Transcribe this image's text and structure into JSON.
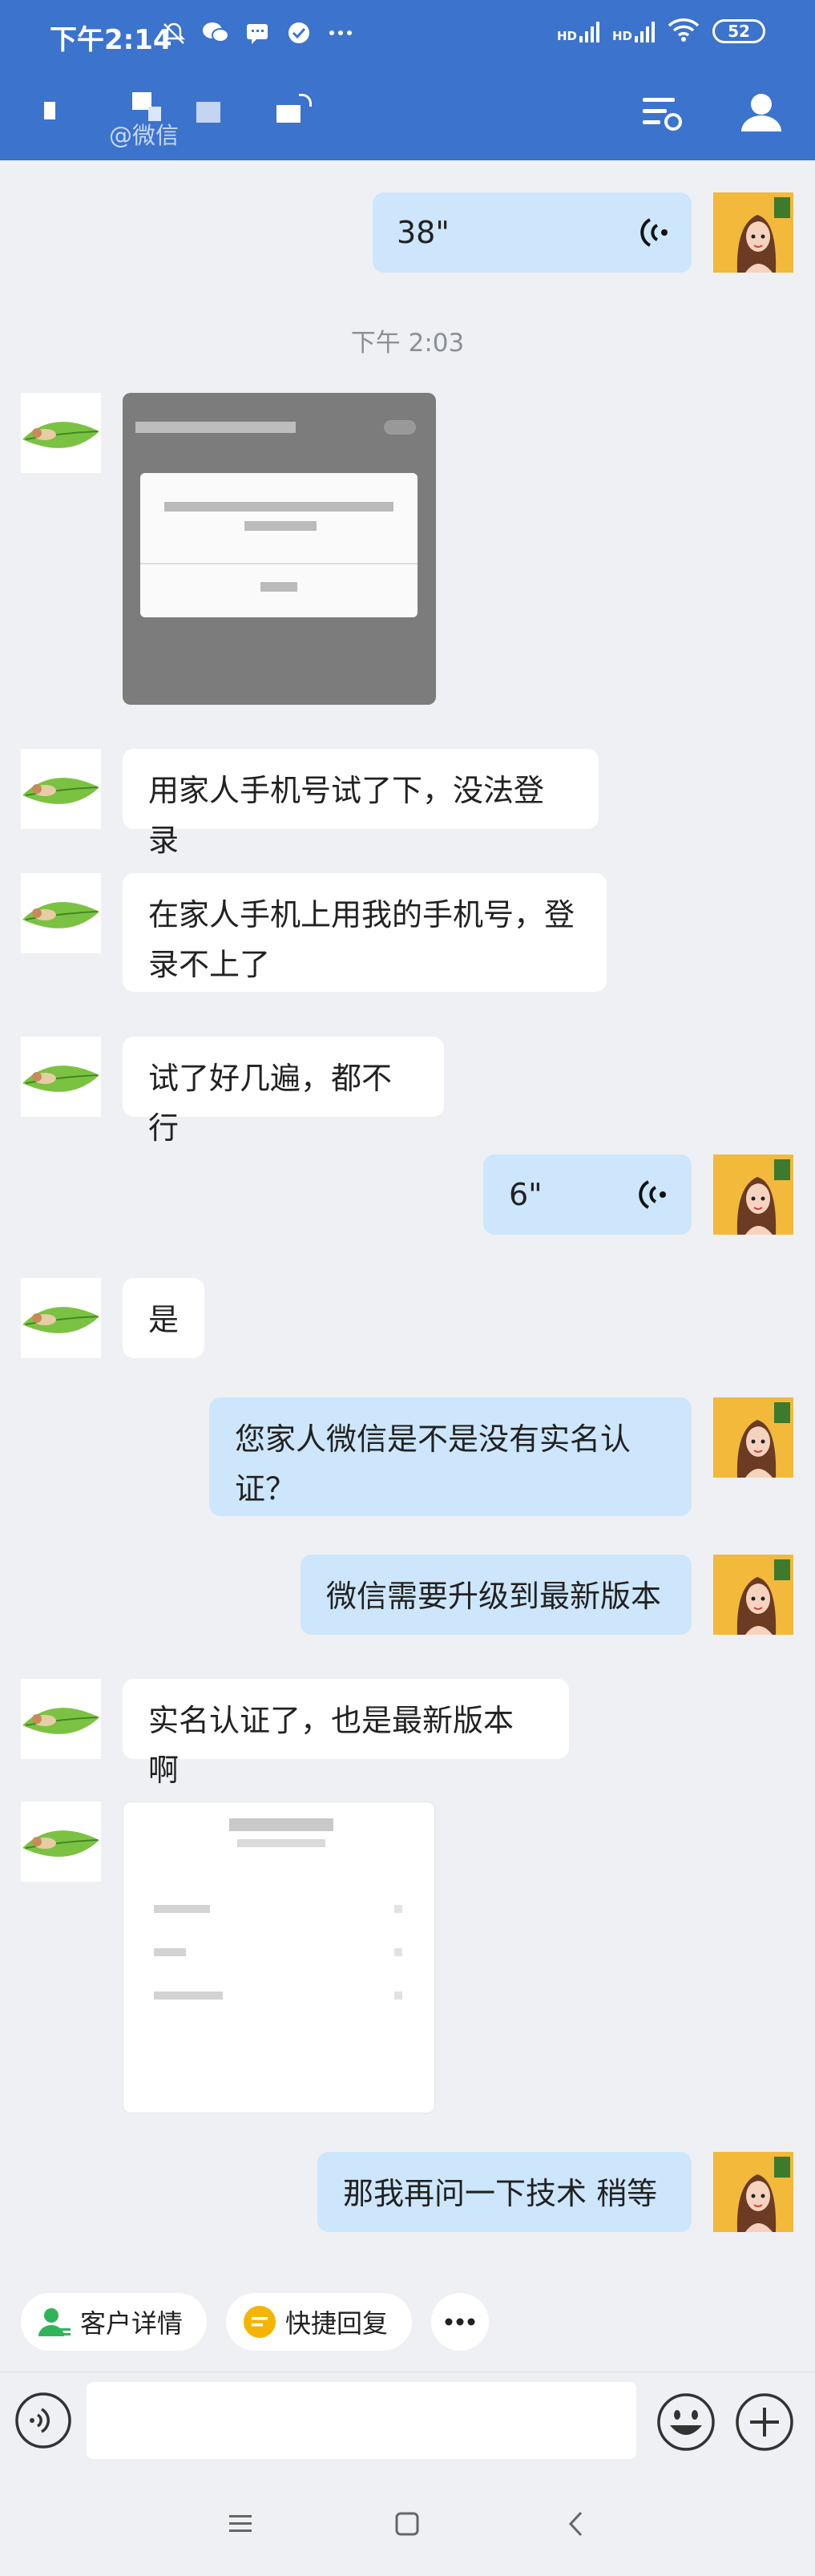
{
  "status_bar": {
    "time": "下午2:14",
    "network_1": "HD",
    "network_2": "HD",
    "battery": "52"
  },
  "header": {
    "subtitle": "@微信"
  },
  "messages": [
    {
      "side": "me",
      "type": "voice",
      "duration": "38\""
    },
    {
      "type": "timestamp",
      "text": "下午 2:03"
    },
    {
      "side": "other",
      "type": "image",
      "caption": "screenshot image (blurred)"
    },
    {
      "side": "other",
      "type": "text",
      "text": "用家人手机号试了下，没法登录"
    },
    {
      "side": "other",
      "type": "text",
      "line1": "在家人手机上用我的手机号，登",
      "line2": "录不上了"
    },
    {
      "side": "other",
      "type": "text",
      "text": "试了好几遍，都不行"
    },
    {
      "side": "me",
      "type": "voice",
      "duration": "6\""
    },
    {
      "side": "other",
      "type": "text",
      "text": "是"
    },
    {
      "side": "me",
      "type": "text",
      "line1": "您家人微信是不是没有实名认",
      "line2": "证？"
    },
    {
      "side": "me",
      "type": "text",
      "text": "微信需要升级到最新版本"
    },
    {
      "side": "other",
      "type": "text",
      "text": "实名认证了，也是最新版本啊"
    },
    {
      "side": "other",
      "type": "image",
      "caption": "screenshot image (blurred)"
    },
    {
      "side": "me",
      "type": "text",
      "text": "那我再问一下技术  稍等"
    }
  ],
  "quick_actions": {
    "customer_detail": "客户详情",
    "quick_reply": "快捷回复"
  },
  "input": {
    "placeholder": ""
  },
  "colors": {
    "header_bg": "#3b73cd",
    "bubble_me": "#cde6fb",
    "bubble_other": "#ffffff",
    "chat_bg": "#eef0f3",
    "customer_icon": "#2fb45a",
    "quick_reply_icon": "#f5b400"
  }
}
